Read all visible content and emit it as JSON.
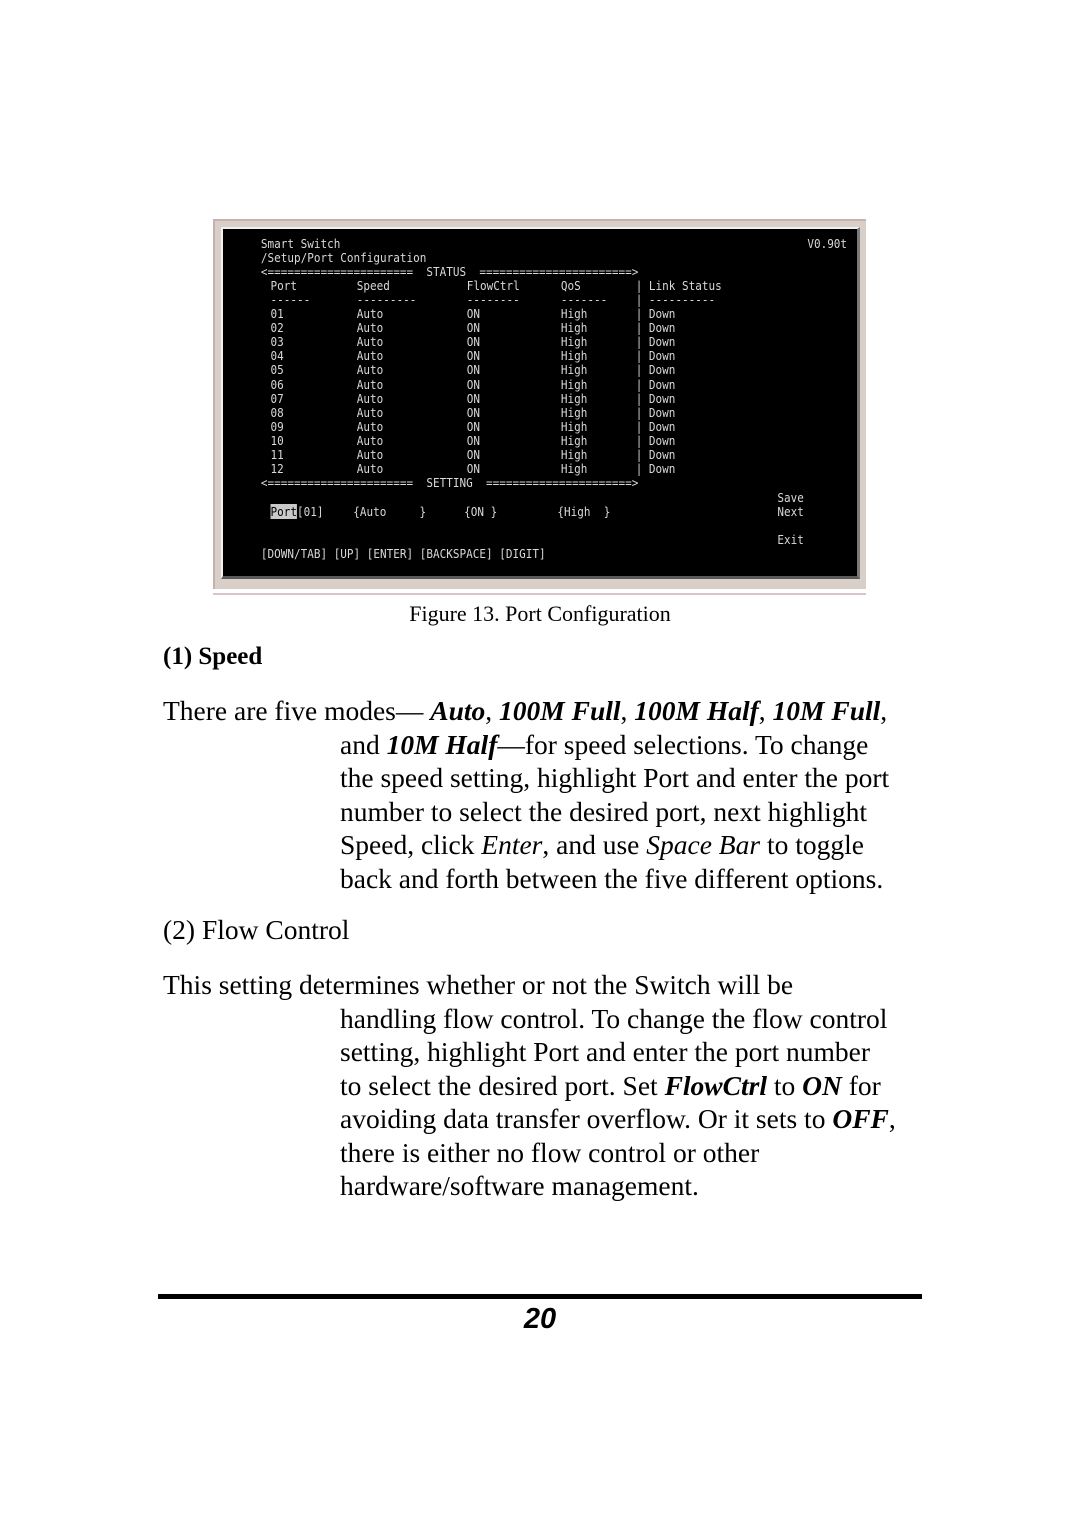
{
  "terminal": {
    "title": "Smart Switch",
    "version": "V0.90t",
    "path": "/Setup/Port Configuration",
    "status_divider": "<======================  STATUS  =======================>",
    "columns": [
      "Port",
      "Speed",
      "FlowCtrl",
      "QoS",
      "Link Status"
    ],
    "dash_row": {
      "port": "------",
      "speed": "---------",
      "flow": "--------",
      "qos": "-------",
      "sep": "|",
      "link": "----------"
    },
    "column_separator": "|",
    "rows": [
      {
        "port": "01",
        "speed": "Auto",
        "flow": "ON",
        "qos": "High",
        "link": "Down"
      },
      {
        "port": "02",
        "speed": "Auto",
        "flow": "ON",
        "qos": "High",
        "link": "Down"
      },
      {
        "port": "03",
        "speed": "Auto",
        "flow": "ON",
        "qos": "High",
        "link": "Down"
      },
      {
        "port": "04",
        "speed": "Auto",
        "flow": "ON",
        "qos": "High",
        "link": "Down"
      },
      {
        "port": "05",
        "speed": "Auto",
        "flow": "ON",
        "qos": "High",
        "link": "Down"
      },
      {
        "port": "06",
        "speed": "Auto",
        "flow": "ON",
        "qos": "High",
        "link": "Down"
      },
      {
        "port": "07",
        "speed": "Auto",
        "flow": "ON",
        "qos": "High",
        "link": "Down"
      },
      {
        "port": "08",
        "speed": "Auto",
        "flow": "ON",
        "qos": "High",
        "link": "Down"
      },
      {
        "port": "09",
        "speed": "Auto",
        "flow": "ON",
        "qos": "High",
        "link": "Down"
      },
      {
        "port": "10",
        "speed": "Auto",
        "flow": "ON",
        "qos": "High",
        "link": "Down"
      },
      {
        "port": "11",
        "speed": "Auto",
        "flow": "ON",
        "qos": "High",
        "link": "Down"
      },
      {
        "port": "12",
        "speed": "Auto",
        "flow": "ON",
        "qos": "High",
        "link": "Down"
      }
    ],
    "setting_divider": "<======================  SETTING  ======================>",
    "setting": {
      "port_label": "Port",
      "port_value": "[01]",
      "speed_value": "{Auto     }",
      "flow_value": "{ON }",
      "qos_value": "{High  }"
    },
    "actions": {
      "save": "Save",
      "next": "Next",
      "exit": "Exit"
    },
    "key_hints": "[DOWN/TAB] [UP] [ENTER] [BACKSPACE] [DIGIT]"
  },
  "caption": "Figure 13. Port Configuration",
  "section1": {
    "heading": "(1) Speed",
    "intro": "There are five modes— ",
    "modes": [
      "Auto",
      "100M Full",
      "100M Half",
      "10M Full",
      "10M Half"
    ],
    "sep1": ", ",
    "end1": ",",
    "and": "and ",
    "after_modes": "—for speed selections. To change",
    "line3": "the speed setting, highlight Port and enter the port",
    "line4": "number to select the desired port, next highlight",
    "line5_a": "Speed, click ",
    "enter": "Enter",
    "line5_b": ", and use ",
    "space_bar": "Space Bar",
    "line5_c": " to toggle",
    "line6": "back and forth between the five different options."
  },
  "section2": {
    "heading": "(2) Flow Control",
    "line1": "This setting determines whether or not the Switch will be",
    "line2": "handling flow control. To change the flow control",
    "line3": "setting, highlight Port and enter the port number",
    "line4_a": "to select the desired port. Set ",
    "flowctrl": "FlowCtrl",
    "line4_b": " to ",
    "on": "ON",
    "line4_c": " for",
    "line5_a": "avoiding data transfer overflow. Or it sets to ",
    "off": "OFF",
    "line5_b": ",",
    "line6": "there is either no flow control or other",
    "line7": "hardware/software management."
  },
  "page_number": "20"
}
